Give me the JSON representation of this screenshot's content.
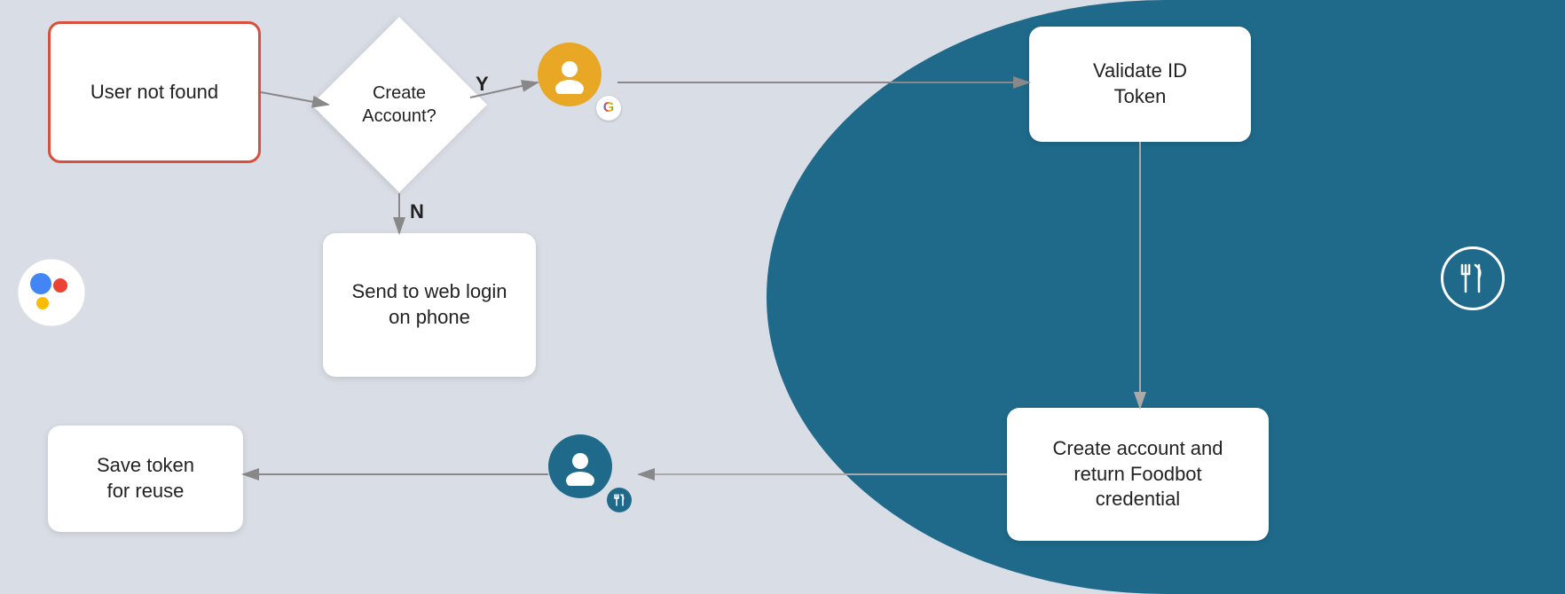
{
  "background": {
    "left_color": "#d9dde5",
    "right_color": "#1f6a8a"
  },
  "boxes": {
    "user_not_found": "User not found",
    "create_account_question": "Create\nAccount?",
    "web_login": "Send to web login\non phone",
    "save_token": "Save token\nfor reuse",
    "validate_id": "Validate ID\nToken",
    "create_account": "Create account and\nreturn Foodbot\ncredential"
  },
  "labels": {
    "yes": "Y",
    "no": "N"
  },
  "icons": {
    "google_user": "google-user-icon",
    "assistant": "google-assistant-icon",
    "foodbot_user": "foodbot-user-icon",
    "fork_knife": "fork-knife-icon",
    "google_letter": "G"
  }
}
